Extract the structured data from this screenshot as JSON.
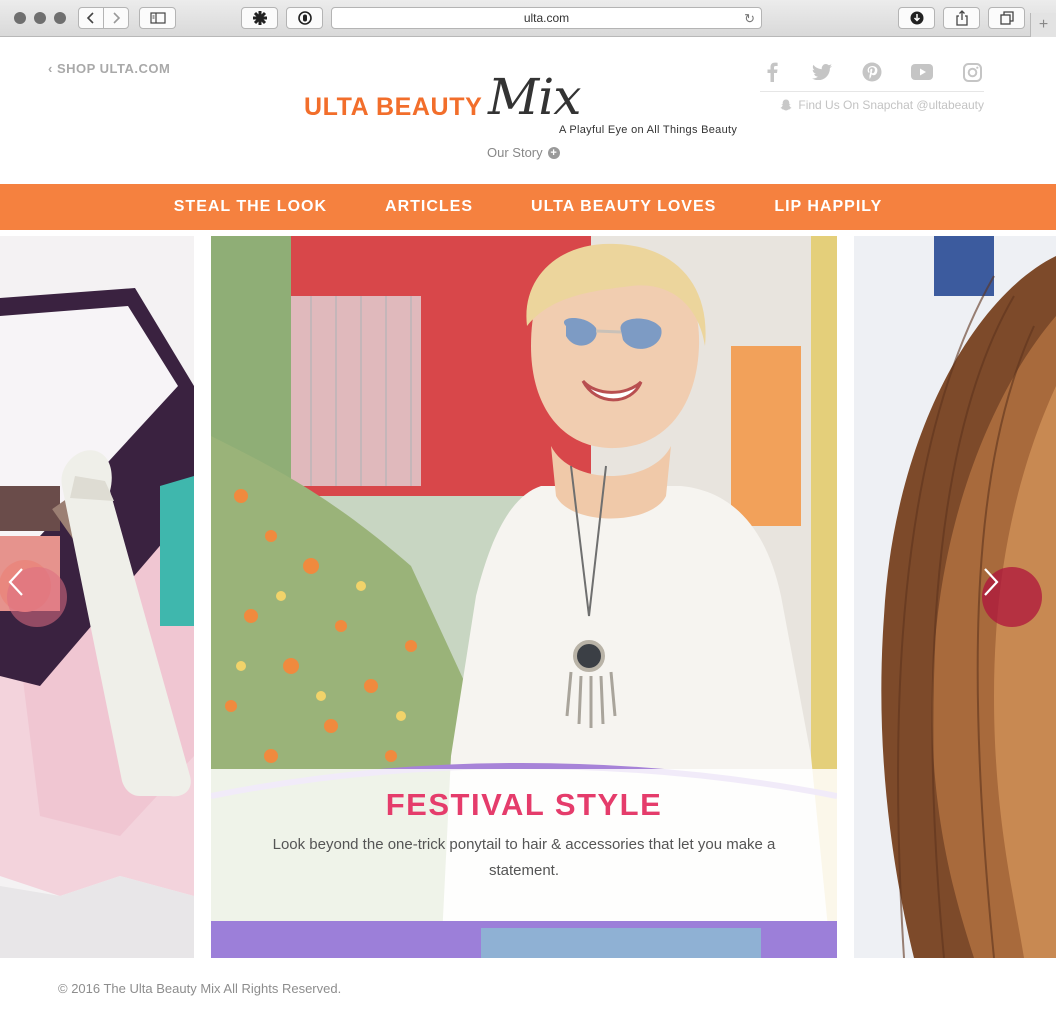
{
  "browser": {
    "url": "ulta.com",
    "icons": [
      "back-icon",
      "forward-icon",
      "sidebar-icon",
      "extension-icon",
      "privacy-icon",
      "reload-icon",
      "download-icon",
      "share-icon",
      "tabs-icon",
      "new-tab-icon"
    ]
  },
  "header": {
    "shop_link": "SHOP ULTA.COM",
    "logo_main": "ULTA BEAUTY",
    "logo_script": "Mix",
    "tagline": "A Playful Eye on All Things Beauty",
    "our_story": "Our Story",
    "snapchat": "Find Us On Snapchat @ultabeauty",
    "social_icons": [
      "facebook-icon",
      "twitter-icon",
      "pinterest-icon",
      "youtube-icon",
      "instagram-icon"
    ]
  },
  "nav": {
    "items": [
      "STEAL THE LOOK",
      "ARTICLES",
      "ULTA BEAUTY LOVES",
      "LIP HAPPILY"
    ]
  },
  "carousel": {
    "active_slide": {
      "title": "FESTIVAL STYLE",
      "text": "Look beyond the one-trick ponytail to hair & accessories that let you make a statement."
    }
  },
  "footer": {
    "copyright": "© 2016 The Ulta Beauty Mix All Rights Reserved."
  },
  "colors": {
    "brand_orange": "#f5813f",
    "logo_orange": "#f26e2b",
    "caption_pink": "#e53c6b"
  }
}
